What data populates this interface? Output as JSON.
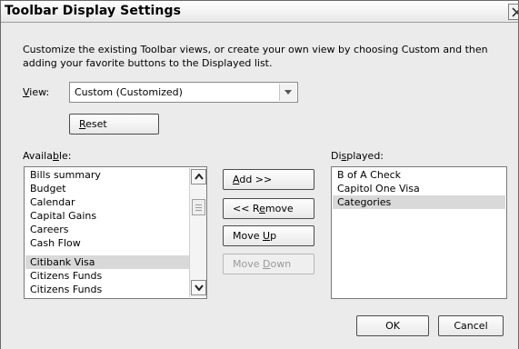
{
  "dialog": {
    "title": "Toolbar Display Settings",
    "description": "Customize the existing Toolbar views, or create your own view by choosing Custom and then adding your favorite buttons to the Displayed list."
  },
  "view": {
    "label_key": "V",
    "label_rest": "iew:",
    "selected": "Custom (Customized)"
  },
  "reset_button": {
    "key": "R",
    "rest": "eset"
  },
  "available": {
    "label_pre": "Availa",
    "label_key": "b",
    "label_post": "le:",
    "items": [
      "Bills summary",
      "Budget",
      "Calendar",
      "Capital Gains",
      "Careers",
      "Cash Flow",
      "Citibank Visa",
      "Citizens Funds",
      "Citizens Funds"
    ],
    "selected_item": "Citibank Visa"
  },
  "displayed": {
    "label_pre": "Di",
    "label_key": "s",
    "label_post": "played:",
    "items": [
      "B of A Check",
      "Capitol One Visa",
      "Categories"
    ],
    "selected_item": "Categories"
  },
  "buttons": {
    "add": {
      "key": "A",
      "rest": "dd >>"
    },
    "remove": {
      "pre": "<< R",
      "key": "e",
      "rest": "move"
    },
    "move_up": {
      "pre": "Move ",
      "key": "U",
      "rest": "p"
    },
    "move_down": {
      "pre": "Move ",
      "key": "D",
      "rest": "own"
    },
    "ok": "OK",
    "cancel": "Cancel"
  },
  "icons": {
    "close": "close-icon",
    "dropdown": "chevron-down-icon",
    "scroll_up": "scroll-up-icon",
    "scroll_down": "scroll-down-icon"
  },
  "colors": {
    "dialog_bg": "#ebebeb",
    "selection": "#d9d9d9",
    "border": "#4c4c4c"
  }
}
